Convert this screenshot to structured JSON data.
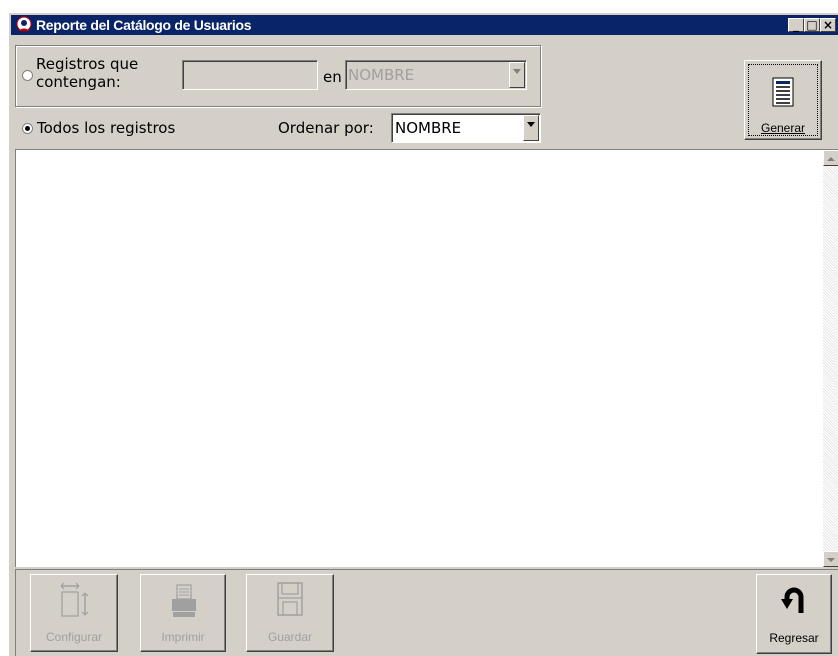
{
  "window": {
    "title": "Reporte del Catálogo de Usuarios",
    "minimize_glyph": "_",
    "maximize_glyph": "□",
    "close_glyph": "×"
  },
  "filter": {
    "option_contains_label_line1": "Registros que",
    "option_contains_label_line2": "contengan:",
    "search_value": "",
    "in_label": "en",
    "field_value": "NOMBRE",
    "option_all_label": "Todos los registros",
    "sort_label": "Ordenar por:",
    "sort_value": "NOMBRE",
    "selected_option": "all"
  },
  "toolbar": {
    "generate_label": "Generar",
    "configure_label": "Configurar",
    "print_label": "Imprimir",
    "save_label": "Guardar",
    "back_label": "Regresar"
  },
  "icons": {
    "title": "app-icon",
    "generate": "document-list-icon",
    "configure": "page-setup-icon",
    "print": "printer-icon",
    "save": "floppy-disk-icon",
    "back": "u-turn-arrow-icon"
  },
  "colors": {
    "titlebar": "#0a246a",
    "face": "#d4d0c8",
    "disabled_text": "#a0a0a0"
  }
}
